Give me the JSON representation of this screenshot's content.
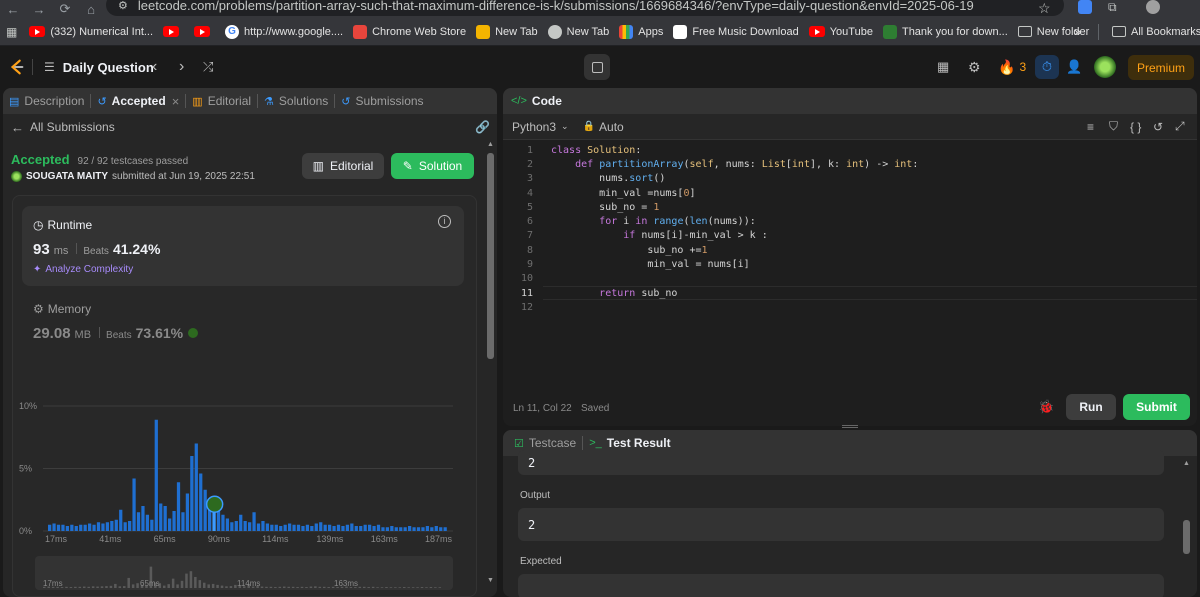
{
  "browser": {
    "url": "leetcode.com/problems/partition-array-such-that-maximum-difference-is-k/submissions/1669684346/?envType=daily-question&envId=2025-06-19",
    "bookmarks": [
      {
        "label": "(332) Numerical Int...",
        "icon": "youtube-icon"
      },
      {
        "label": "",
        "icon": "youtube-icon"
      },
      {
        "label": "",
        "icon": "youtube-icon"
      },
      {
        "label": "http://www.google....",
        "icon": "google-icon"
      },
      {
        "label": "Chrome Web Store",
        "icon": "chrome-store-icon"
      },
      {
        "label": "New Tab",
        "icon": "newtab-icon"
      },
      {
        "label": "New Tab",
        "icon": "globe-icon"
      },
      {
        "label": "Apps",
        "icon": "apps-grid-icon"
      },
      {
        "label": "Free Music Download",
        "icon": "page-icon"
      },
      {
        "label": "YouTube",
        "icon": "youtube-icon"
      },
      {
        "label": "Thank you for down...",
        "icon": "download-icon"
      },
      {
        "label": "New folder",
        "icon": "folder-icon"
      }
    ],
    "more_bookmarks": "»",
    "all_bookmarks": "All Bookmarks"
  },
  "header": {
    "title": "Daily Question",
    "streak": "3",
    "premium": "Premium"
  },
  "left": {
    "tabs": [
      {
        "label": "Description",
        "icon": "description-icon"
      },
      {
        "label": "Accepted",
        "icon": "history-icon"
      },
      {
        "label": "Editorial",
        "icon": "book-icon"
      },
      {
        "label": "Solutions",
        "icon": "flask-icon"
      },
      {
        "label": "Submissions",
        "icon": "history-icon"
      }
    ],
    "close": "×",
    "back_label": "All Submissions",
    "status": "Accepted",
    "testcases": "92 / 92 testcases passed",
    "user": "SOUGATA MAITY",
    "submitted": "submitted at Jun 19, 2025 22:51",
    "editorial_btn": "Editorial",
    "solution_btn": "Solution",
    "runtime": {
      "title": "Runtime",
      "value": "93",
      "unit": "ms",
      "beats_label": "Beats",
      "beats": "41.24%",
      "analyze": "Analyze Complexity"
    },
    "memory": {
      "title": "Memory",
      "value": "29.08",
      "unit": "MB",
      "beats_label": "Beats",
      "beats": "73.61%"
    }
  },
  "chart_data": {
    "type": "bar",
    "y_ticks": [
      "10%",
      "5%",
      "0%"
    ],
    "ylim": [
      0,
      10
    ],
    "x_ticks": [
      "17ms",
      "41ms",
      "65ms",
      "90ms",
      "114ms",
      "139ms",
      "163ms",
      "187ms"
    ],
    "values": [
      0.5,
      0.6,
      0.5,
      0.5,
      0.4,
      0.5,
      0.4,
      0.5,
      0.5,
      0.6,
      0.5,
      0.7,
      0.6,
      0.7,
      0.8,
      0.9,
      1.7,
      0.7,
      0.8,
      4.2,
      1.5,
      2.0,
      1.3,
      0.9,
      8.9,
      2.2,
      2.0,
      1.0,
      1.6,
      3.9,
      1.5,
      3.0,
      6.0,
      7.0,
      4.6,
      3.3,
      2.2,
      1.5,
      1.7,
      1.3,
      1.0,
      0.7,
      0.8,
      1.3,
      0.8,
      0.7,
      1.5,
      0.6,
      0.8,
      0.6,
      0.5,
      0.5,
      0.4,
      0.5,
      0.6,
      0.5,
      0.5,
      0.4,
      0.5,
      0.4,
      0.6,
      0.7,
      0.5,
      0.5,
      0.4,
      0.5,
      0.4,
      0.5,
      0.6,
      0.4,
      0.4,
      0.5,
      0.5,
      0.4,
      0.5,
      0.3,
      0.3,
      0.4,
      0.3,
      0.3,
      0.3,
      0.4,
      0.3,
      0.3,
      0.3,
      0.4,
      0.3,
      0.4,
      0.3,
      0.3
    ],
    "highlight_index": 37,
    "mini_ticks": [
      "17ms",
      "65ms",
      "114ms",
      "163ms"
    ]
  },
  "editor": {
    "tab": "Code",
    "language": "Python3",
    "mode": "Auto",
    "code": [
      "class Solution:",
      "    def partitionArray(self, nums: List[int], k: int) -> int:",
      "        nums.sort()",
      "        min_val =nums[0]",
      "        sub_no = 1",
      "        for i in range(len(nums)):",
      "            if nums[i]-min_val > k :",
      "                sub_no +=1",
      "                min_val = nums[i]",
      "",
      "        return sub_no",
      ""
    ],
    "line_numbers": [
      "1",
      "2",
      "3",
      "4",
      "5",
      "6",
      "7",
      "8",
      "9",
      "10",
      "11",
      "12"
    ],
    "cursor": "Ln 11, Col 22",
    "saved": "Saved",
    "run": "Run",
    "submit": "Submit"
  },
  "result": {
    "tabs": [
      {
        "label": "Testcase",
        "icon": "checkbox-icon"
      },
      {
        "label": "Test Result",
        "icon": "terminal-icon"
      }
    ],
    "input_last": "2",
    "output_label": "Output",
    "output": "2",
    "expected_label": "Expected"
  }
}
